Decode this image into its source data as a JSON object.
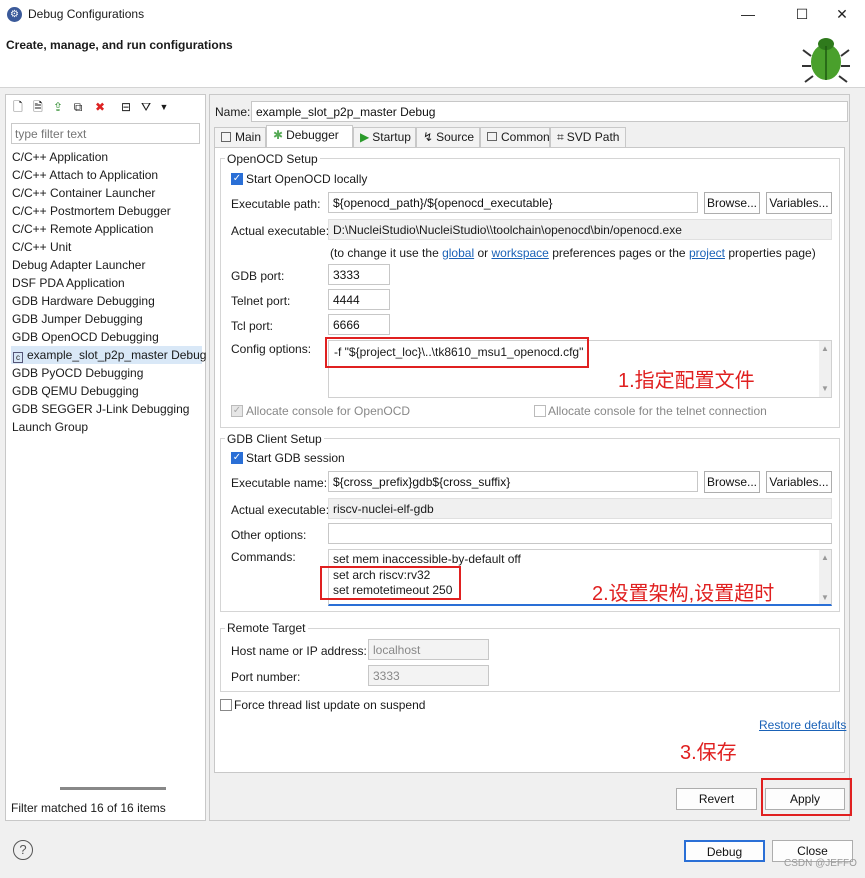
{
  "window": {
    "title": "Debug Configurations",
    "subtitle": "Create, manage, and run configurations",
    "minimize": "—",
    "maximize": "☐",
    "close": "✕"
  },
  "left": {
    "filter_placeholder": "type filter text",
    "items": [
      "C/C++ Application",
      "C/C++ Attach to Application",
      "C/C++ Container Launcher",
      "C/C++ Postmortem Debugger",
      "C/C++ Remote Application",
      "C/C++ Unit",
      "Debug Adapter Launcher",
      "DSF PDA Application",
      "GDB Hardware Debugging",
      "GDB Jumper Debugging",
      "GDB OpenOCD Debugging",
      "example_slot_p2p_master Debug",
      "GDB PyOCD Debugging",
      "GDB QEMU Debugging",
      "GDB SEGGER J-Link Debugging",
      "Launch Group"
    ],
    "status": "Filter matched 16 of 16 items"
  },
  "name_label": "Name:",
  "name_value": "example_slot_p2p_master Debug",
  "tabs": [
    "Main",
    "Debugger",
    "Startup",
    "Source",
    "Common",
    "SVD Path"
  ],
  "openocd": {
    "group_title": "OpenOCD Setup",
    "start_label": "Start OpenOCD locally",
    "exec_label": "Executable path:",
    "exec_value": "${openocd_path}/${openocd_executable}",
    "browse": "Browse...",
    "variables": "Variables...",
    "actual_label": "Actual executable:",
    "actual_value": "D:\\NucleiStudio\\NucleiStudio\\\\toolchain\\openocd\\bin/openocd.exe",
    "hint_pre": "(to change it use the",
    "hint_global": "global",
    "hint_or": "or",
    "hint_workspace": "workspace",
    "hint_mid": "preferences pages or the",
    "hint_project": "project",
    "hint_post": "properties page)",
    "gdb_port_label": "GDB port:",
    "gdb_port": "3333",
    "telnet_port_label": "Telnet port:",
    "telnet_port": "4444",
    "tcl_port_label": "Tcl port:",
    "tcl_port": "6666",
    "config_label": "Config options:",
    "config_value": "-f \"${project_loc}\\..\\tk8610_msu1_openocd.cfg\"",
    "alloc_console": "Allocate console for OpenOCD",
    "alloc_telnet": "Allocate console for the telnet connection"
  },
  "gdb": {
    "group_title": "GDB Client Setup",
    "start_label": "Start GDB session",
    "exec_label": "Executable name:",
    "exec_value": "${cross_prefix}gdb${cross_suffix}",
    "browse": "Browse...",
    "variables": "Variables...",
    "actual_label": "Actual executable:",
    "actual_value": "riscv-nuclei-elf-gdb",
    "other_label": "Other options:",
    "other_value": "",
    "commands_label": "Commands:",
    "commands": [
      "set mem inaccessible-by-default off",
      "set arch riscv:rv32",
      "set remotetimeout 250"
    ]
  },
  "remote": {
    "group_title": "Remote Target",
    "host_label": "Host name or IP address:",
    "host_value": "localhost",
    "port_label": "Port number:",
    "port_value": "3333"
  },
  "force_thread": "Force thread list update on suspend",
  "restore_defaults": "Restore defaults",
  "revert": "Revert",
  "apply": "Apply",
  "debug": "Debug",
  "close": "Close",
  "help": "?",
  "annotations": {
    "a1": "1.指定配置文件",
    "a2": "2.设置架构,设置超时",
    "a3": "3.保存"
  },
  "watermark": "CSDN @JEFFO",
  "colors": {
    "annotation": "#e02020",
    "link": "#1a62b7",
    "accent": "#2a6fd6"
  }
}
